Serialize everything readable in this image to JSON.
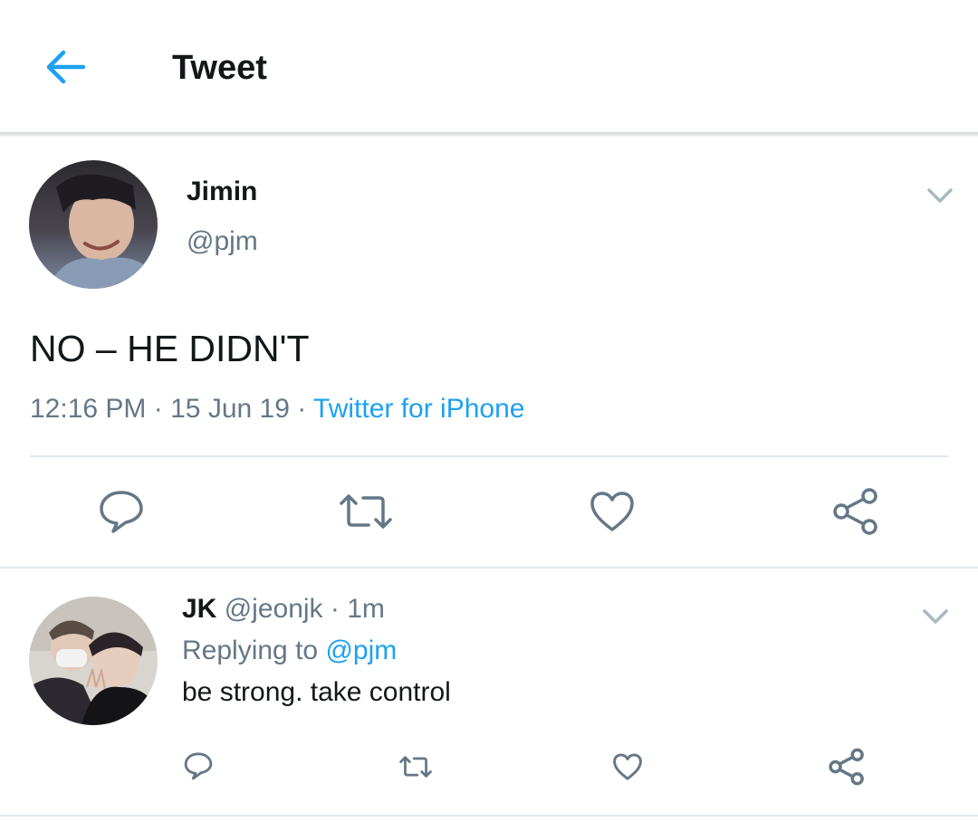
{
  "header": {
    "title": "Tweet",
    "back_icon": "arrow-left-icon",
    "accent_color": "#1da1f2"
  },
  "tweet": {
    "author_name": "Jimin",
    "author_handle": "@pjm",
    "text": "NO – HE DIDN'T",
    "time": "12:16 PM",
    "date": "15 Jun 19",
    "separator": "·",
    "source": "Twitter for iPhone",
    "actions": [
      "reply-icon",
      "retweet-icon",
      "like-icon",
      "share-icon"
    ]
  },
  "reply": {
    "author_name": "JK",
    "author_handle": "@jeonjk",
    "time_ago": "1m",
    "separator": "·",
    "replying_label": "Replying to",
    "replying_to": "@pjm",
    "text": "be strong. take control",
    "actions": [
      "reply-icon",
      "retweet-icon",
      "like-icon",
      "share-icon"
    ]
  },
  "colors": {
    "text": "#14171a",
    "secondary": "#657786",
    "link": "#1da1f2",
    "divider": "#e1e8ed",
    "icon": "#657786"
  }
}
